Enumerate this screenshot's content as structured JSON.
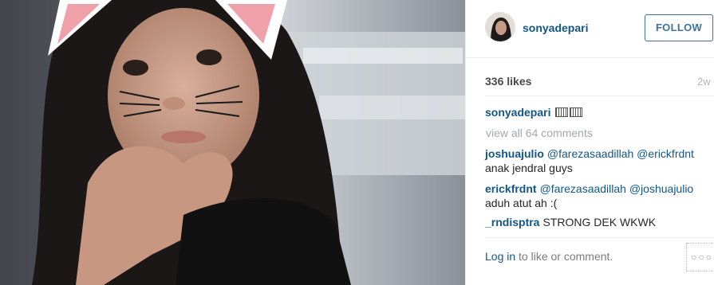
{
  "post": {
    "username": "sonyadepari",
    "follow_label": "FOLLOW",
    "likes": "336 likes",
    "time": "2w",
    "caption_user": "sonyadepari",
    "view_all": "view all 64 comments",
    "comments": [
      {
        "user": "joshuajulio",
        "tags": "@farezasaadillah @erickfrdnt",
        "text": "anak jendral guys"
      },
      {
        "user": "erickfrdnt",
        "tags": "@farezasaadillah @joshuajulio",
        "text": "aduh atut ah :("
      },
      {
        "user": "_rndisptra",
        "tags": "",
        "text": "STRONG DEK WKWK"
      }
    ],
    "login_link": "Log in",
    "login_rest": " to like or comment.",
    "more_icon": "ellipsis-icon",
    "more_label": "○○○"
  },
  "colors": {
    "link": "#125688",
    "button": "#3f729b",
    "muted": "#a5a7aa"
  }
}
